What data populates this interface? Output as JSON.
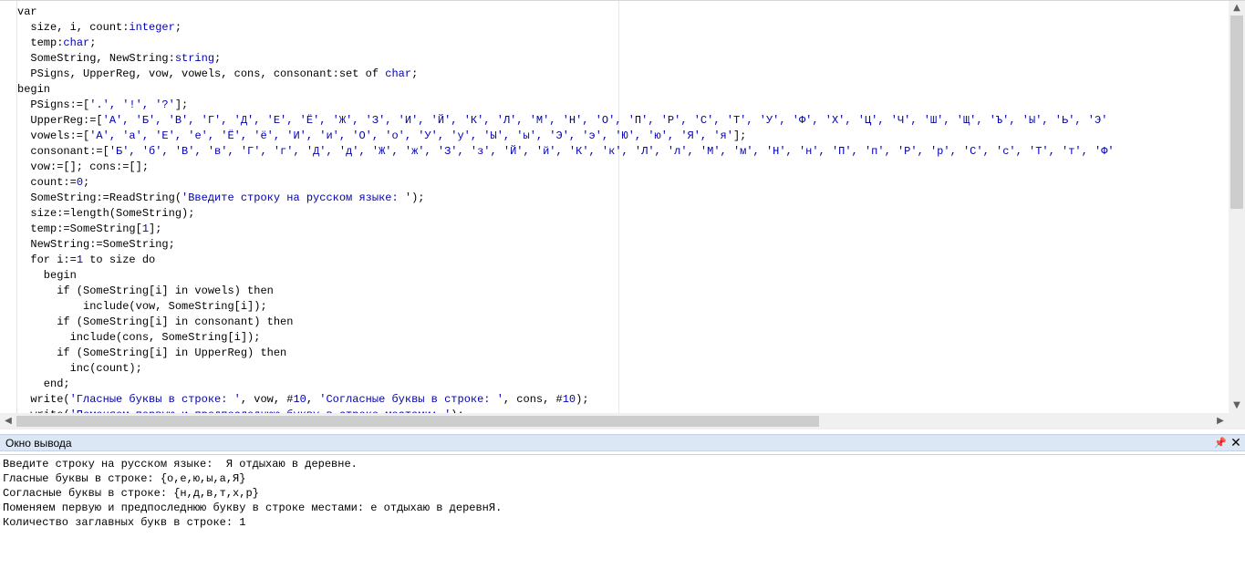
{
  "editor": {
    "lines": [
      [
        {
          "t": "var",
          "c": "kw"
        }
      ],
      [
        {
          "t": "  size, i, count:",
          "c": "kw"
        },
        {
          "t": "integer",
          "c": "ty"
        },
        {
          "t": ";",
          "c": "kw"
        }
      ],
      [
        {
          "t": "  temp:",
          "c": "kw"
        },
        {
          "t": "char",
          "c": "ty"
        },
        {
          "t": ";",
          "c": "kw"
        }
      ],
      [
        {
          "t": "  SomeString, NewString:",
          "c": "kw"
        },
        {
          "t": "string",
          "c": "ty"
        },
        {
          "t": ";",
          "c": "kw"
        }
      ],
      [
        {
          "t": "  PSigns, UpperReg, vow, vowels, cons, consonant:set of ",
          "c": "kw"
        },
        {
          "t": "char",
          "c": "ty"
        },
        {
          "t": ";",
          "c": "kw"
        }
      ],
      [
        {
          "t": "begin",
          "c": "kw"
        }
      ],
      [
        {
          "t": "  PSigns:=[",
          "c": "kw"
        },
        {
          "t": "'.', '!', '?'",
          "c": "st"
        },
        {
          "t": "];",
          "c": "kw"
        }
      ],
      [
        {
          "t": "  UpperReg:=[",
          "c": "kw"
        },
        {
          "t": "'А', 'Б', 'В', 'Г', 'Д', 'Е', 'Ё', 'Ж', 'З', 'И', 'Й', 'К', 'Л', 'М', 'Н', 'О', 'П', 'Р', 'С', 'Т', 'У', 'Ф', 'Х', 'Ц', 'Ч', 'Ш', 'Щ', 'Ъ', 'Ы', 'Ь', 'Э'",
          "c": "st"
        }
      ],
      [
        {
          "t": "  vowels:=[",
          "c": "kw"
        },
        {
          "t": "'А', 'а', 'Е', 'е', 'Ё', 'ё', 'И', 'и', 'О', 'о', 'У', 'у', 'Ы', 'ы', 'Э', 'э', 'Ю', 'ю', 'Я', 'я'",
          "c": "st"
        },
        {
          "t": "];",
          "c": "kw"
        }
      ],
      [
        {
          "t": "  consonant:=[",
          "c": "kw"
        },
        {
          "t": "'Б', 'б', 'В', 'в', 'Г', 'г', 'Д', 'д', 'Ж', 'ж', 'З', 'з', 'Й', 'й', 'К', 'к', 'Л', 'л', 'М', 'м', 'Н', 'н', 'П', 'п', 'Р', 'р', 'С', 'с', 'Т', 'т', 'Ф'",
          "c": "st"
        }
      ],
      [
        {
          "t": "  vow:=[]; cons:=[];",
          "c": "kw"
        }
      ],
      [
        {
          "t": "  count:=",
          "c": "kw"
        },
        {
          "t": "0",
          "c": "nm"
        },
        {
          "t": ";",
          "c": "kw"
        }
      ],
      [
        {
          "t": "  SomeString:=ReadString(",
          "c": "kw"
        },
        {
          "t": "'Введите строку на русском языке: '",
          "c": "st"
        },
        {
          "t": ");",
          "c": "kw"
        }
      ],
      [
        {
          "t": "  size:=length(SomeString);",
          "c": "kw"
        }
      ],
      [
        {
          "t": "  temp:=SomeString[",
          "c": "kw"
        },
        {
          "t": "1",
          "c": "nm"
        },
        {
          "t": "];",
          "c": "kw"
        }
      ],
      [
        {
          "t": "  NewString:=SomeString;",
          "c": "kw"
        }
      ],
      [
        {
          "t": "  for i:=",
          "c": "kw"
        },
        {
          "t": "1",
          "c": "nm"
        },
        {
          "t": " to size do",
          "c": "kw"
        }
      ],
      [
        {
          "t": "    begin",
          "c": "kw"
        }
      ],
      [
        {
          "t": "      if (SomeString[i] in vowels) then",
          "c": "kw"
        }
      ],
      [
        {
          "t": "          include(vow, SomeString[i]);",
          "c": "kw"
        }
      ],
      [
        {
          "t": "      if (SomeString[i] in consonant) then",
          "c": "kw"
        }
      ],
      [
        {
          "t": "        include(cons, SomeString[i]);",
          "c": "kw"
        }
      ],
      [
        {
          "t": "      if (SomeString[i] in UpperReg) then",
          "c": "kw"
        }
      ],
      [
        {
          "t": "        inc(count);",
          "c": "kw"
        }
      ],
      [
        {
          "t": "    end;",
          "c": "kw"
        }
      ],
      [
        {
          "t": "  write(",
          "c": "kw"
        },
        {
          "t": "'Гласные буквы в строке: '",
          "c": "st"
        },
        {
          "t": ", vow, #",
          "c": "kw"
        },
        {
          "t": "10",
          "c": "nm"
        },
        {
          "t": ", ",
          "c": "kw"
        },
        {
          "t": "'Согласные буквы в строке: '",
          "c": "st"
        },
        {
          "t": ", cons, #",
          "c": "kw"
        },
        {
          "t": "10",
          "c": "nm"
        },
        {
          "t": ");",
          "c": "kw"
        }
      ],
      [
        {
          "t": "  write(",
          "c": "kw"
        },
        {
          "t": "'Поменяем первую и предпоследнюю букву в строке местами: '",
          "c": "st"
        },
        {
          "t": ");",
          "c": "kw"
        }
      ]
    ]
  },
  "output_panel": {
    "title": "Окно вывода",
    "pin_icon": "pin-icon",
    "close_icon": "close-icon",
    "lines": [
      "Введите строку на русском языке:  Я отдыхаю в деревне.",
      "Гласные буквы в строке: {о,е,ю,ы,а,Я}",
      "Согласные буквы в строке: {н,д,в,т,х,р}",
      "Поменяем первую и предпоследнюю букву в строке местами: е отдыхаю в деревнЯ.",
      "Количество заглавных букв в строке: 1"
    ]
  },
  "colors": {
    "keyword": "#000000",
    "type": "#0000c0",
    "string": "#0000b0",
    "panel_header": "#dce7f5"
  }
}
